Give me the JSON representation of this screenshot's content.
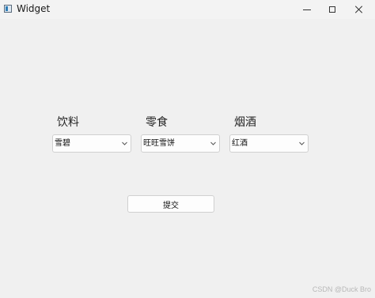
{
  "window": {
    "title": "Widget",
    "controls": {
      "minimize_icon": "minimize-icon",
      "maximize_icon": "maximize-icon",
      "close_icon": "close-icon"
    }
  },
  "categories": [
    {
      "label": "饮料",
      "selected": "雪碧"
    },
    {
      "label": "零食",
      "selected": "旺旺雪饼"
    },
    {
      "label": "烟酒",
      "selected": "红酒"
    }
  ],
  "submit": {
    "label": "提交"
  },
  "watermark": "CSDN @Duck Bro"
}
